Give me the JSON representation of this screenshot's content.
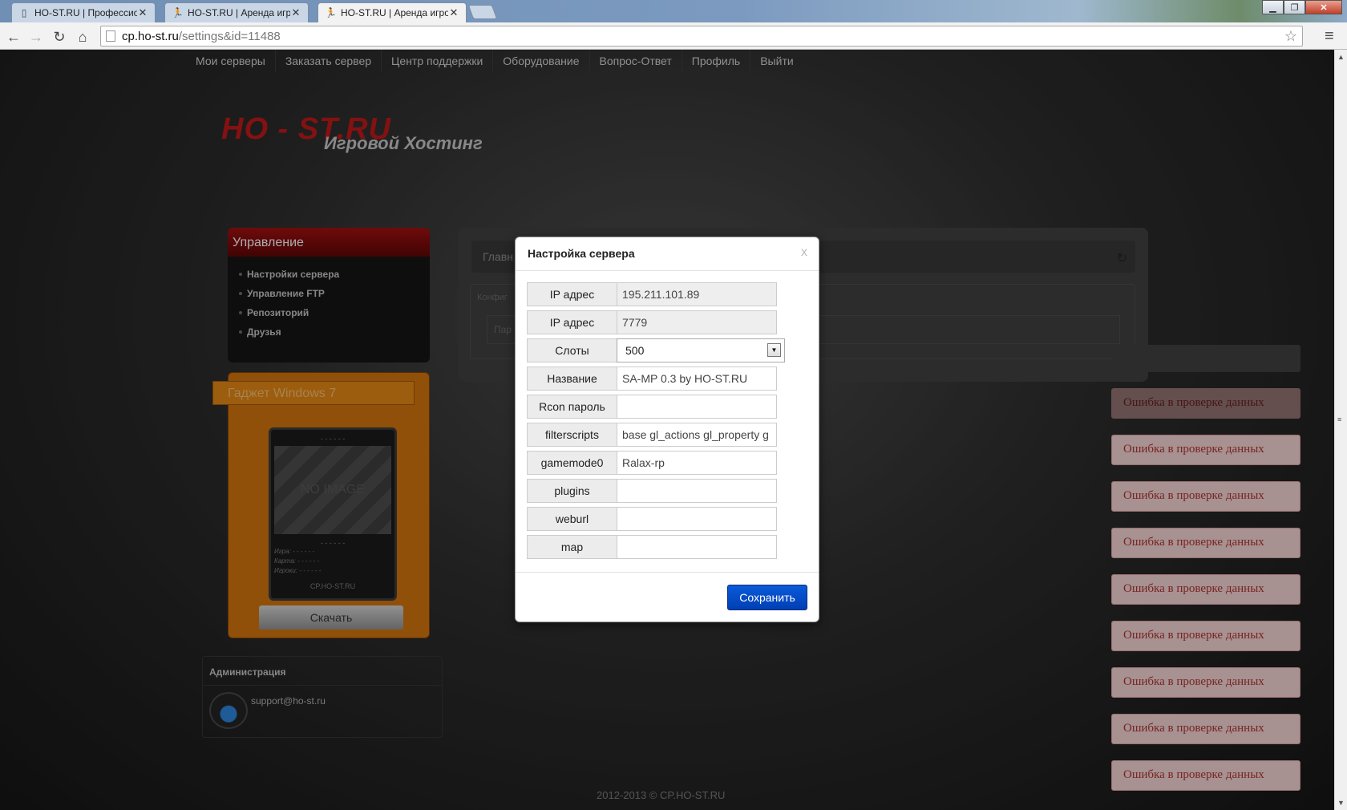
{
  "browser": {
    "tabs": [
      {
        "title": "HO-ST.RU | Профессион",
        "icon": "document-icon",
        "active": false
      },
      {
        "title": "HO-ST.RU | Аренда игров",
        "icon": "runner-icon",
        "active": false
      },
      {
        "title": "HO-ST.RU | Аренда игров",
        "icon": "runner-icon",
        "active": true
      }
    ],
    "url_host": "cp.ho-st.ru",
    "url_path": "/settings&id=11488"
  },
  "topnav": [
    "Мои серверы",
    "Заказать сервер",
    "Центр поддержки",
    "Оборудование",
    "Вопрос-Ответ",
    "Профиль",
    "Выйти"
  ],
  "logo": {
    "main": "HO - ST.RU",
    "sub": "Игровой Хостинг"
  },
  "sidebar": {
    "title": "Управление",
    "items": [
      "Настройки сервера",
      "Управление FTP",
      "Репозиторий",
      "Друзья"
    ]
  },
  "gadget": {
    "title": "Гаджет Windows 7",
    "dashes": "- - - - - -",
    "no_image": "NO IMAGE",
    "game_line": "Игра: - - - - - -",
    "map_line": "Карта: - - - - - -",
    "players_line": "Игроки: - - - - - -",
    "footer": "CP.HO-ST.RU",
    "download": "Скачать"
  },
  "admin": {
    "title": "Администрация",
    "email": "support@ho-st.ru"
  },
  "main": {
    "crumb": "Главн",
    "config_tab": "Конфиг",
    "param": "Пар"
  },
  "notifications": {
    "text": "Ошибка в проверке данных",
    "count_visible": 9
  },
  "footer": "2012-2013 © CP.HO-ST.RU",
  "modal": {
    "title": "Настройка сервера",
    "close": "x",
    "fields": {
      "ip": {
        "label": "IP адрес",
        "value": "195.211.101.89"
      },
      "port": {
        "label": "IP адрес",
        "value": "7779"
      },
      "slots": {
        "label": "Слоты",
        "value": "500"
      },
      "name": {
        "label": "Название",
        "value": "SA-MP 0.3 by HO-ST.RU"
      },
      "rcon": {
        "label": "Rcon пароль",
        "value": ""
      },
      "filterscripts": {
        "label": "filterscripts",
        "value": "base gl_actions gl_property g"
      },
      "gamemode0": {
        "label": "gamemode0",
        "value": "Ralax-rp"
      },
      "plugins": {
        "label": "plugins",
        "value": ""
      },
      "weburl": {
        "label": "weburl",
        "value": ""
      },
      "map": {
        "label": "map",
        "value": ""
      }
    },
    "save": "Сохранить"
  },
  "colors": {
    "brand_red": "#b81818",
    "error_bg": "#e8c9c9",
    "error_text": "#a5332f",
    "save_blue": "#0a4fc8"
  }
}
